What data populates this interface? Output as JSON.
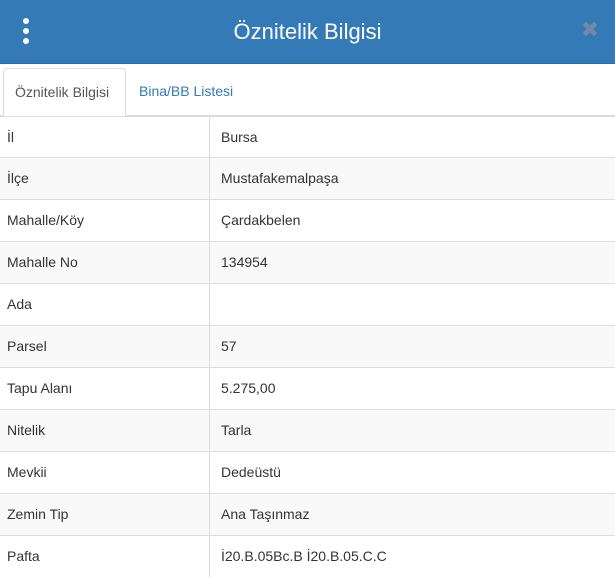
{
  "header": {
    "title": "Öznitelik Bilgisi",
    "close_symbol": "✖",
    "menu_icon": "kebab-menu-icon",
    "close_icon": "close-icon"
  },
  "tabs": [
    {
      "label": "Öznitelik Bilgisi",
      "active": true
    },
    {
      "label": "Bina/BB Listesi",
      "active": false
    }
  ],
  "attributes": [
    {
      "label": "İl",
      "value": "Bursa"
    },
    {
      "label": "İlçe",
      "value": "Mustafakemalpaşa"
    },
    {
      "label": "Mahalle/Köy",
      "value": "Çardakbelen"
    },
    {
      "label": "Mahalle No",
      "value": "134954"
    },
    {
      "label": "Ada",
      "value": ""
    },
    {
      "label": "Parsel",
      "value": "57"
    },
    {
      "label": "Tapu Alanı",
      "value": "5.275,00"
    },
    {
      "label": "Nitelik",
      "value": "Tarla"
    },
    {
      "label": "Mevkii",
      "value": "Dedeüstü"
    },
    {
      "label": "Zemin Tip",
      "value": "Ana Taşınmaz"
    },
    {
      "label": "Pafta",
      "value": "İ20.B.05Bc.B İ20.B.05.C.C"
    }
  ],
  "colors": {
    "header_bg": "#337ab7",
    "link": "#337ab7",
    "row_stripe": "#f9f9f9",
    "border": "#dddddd"
  }
}
